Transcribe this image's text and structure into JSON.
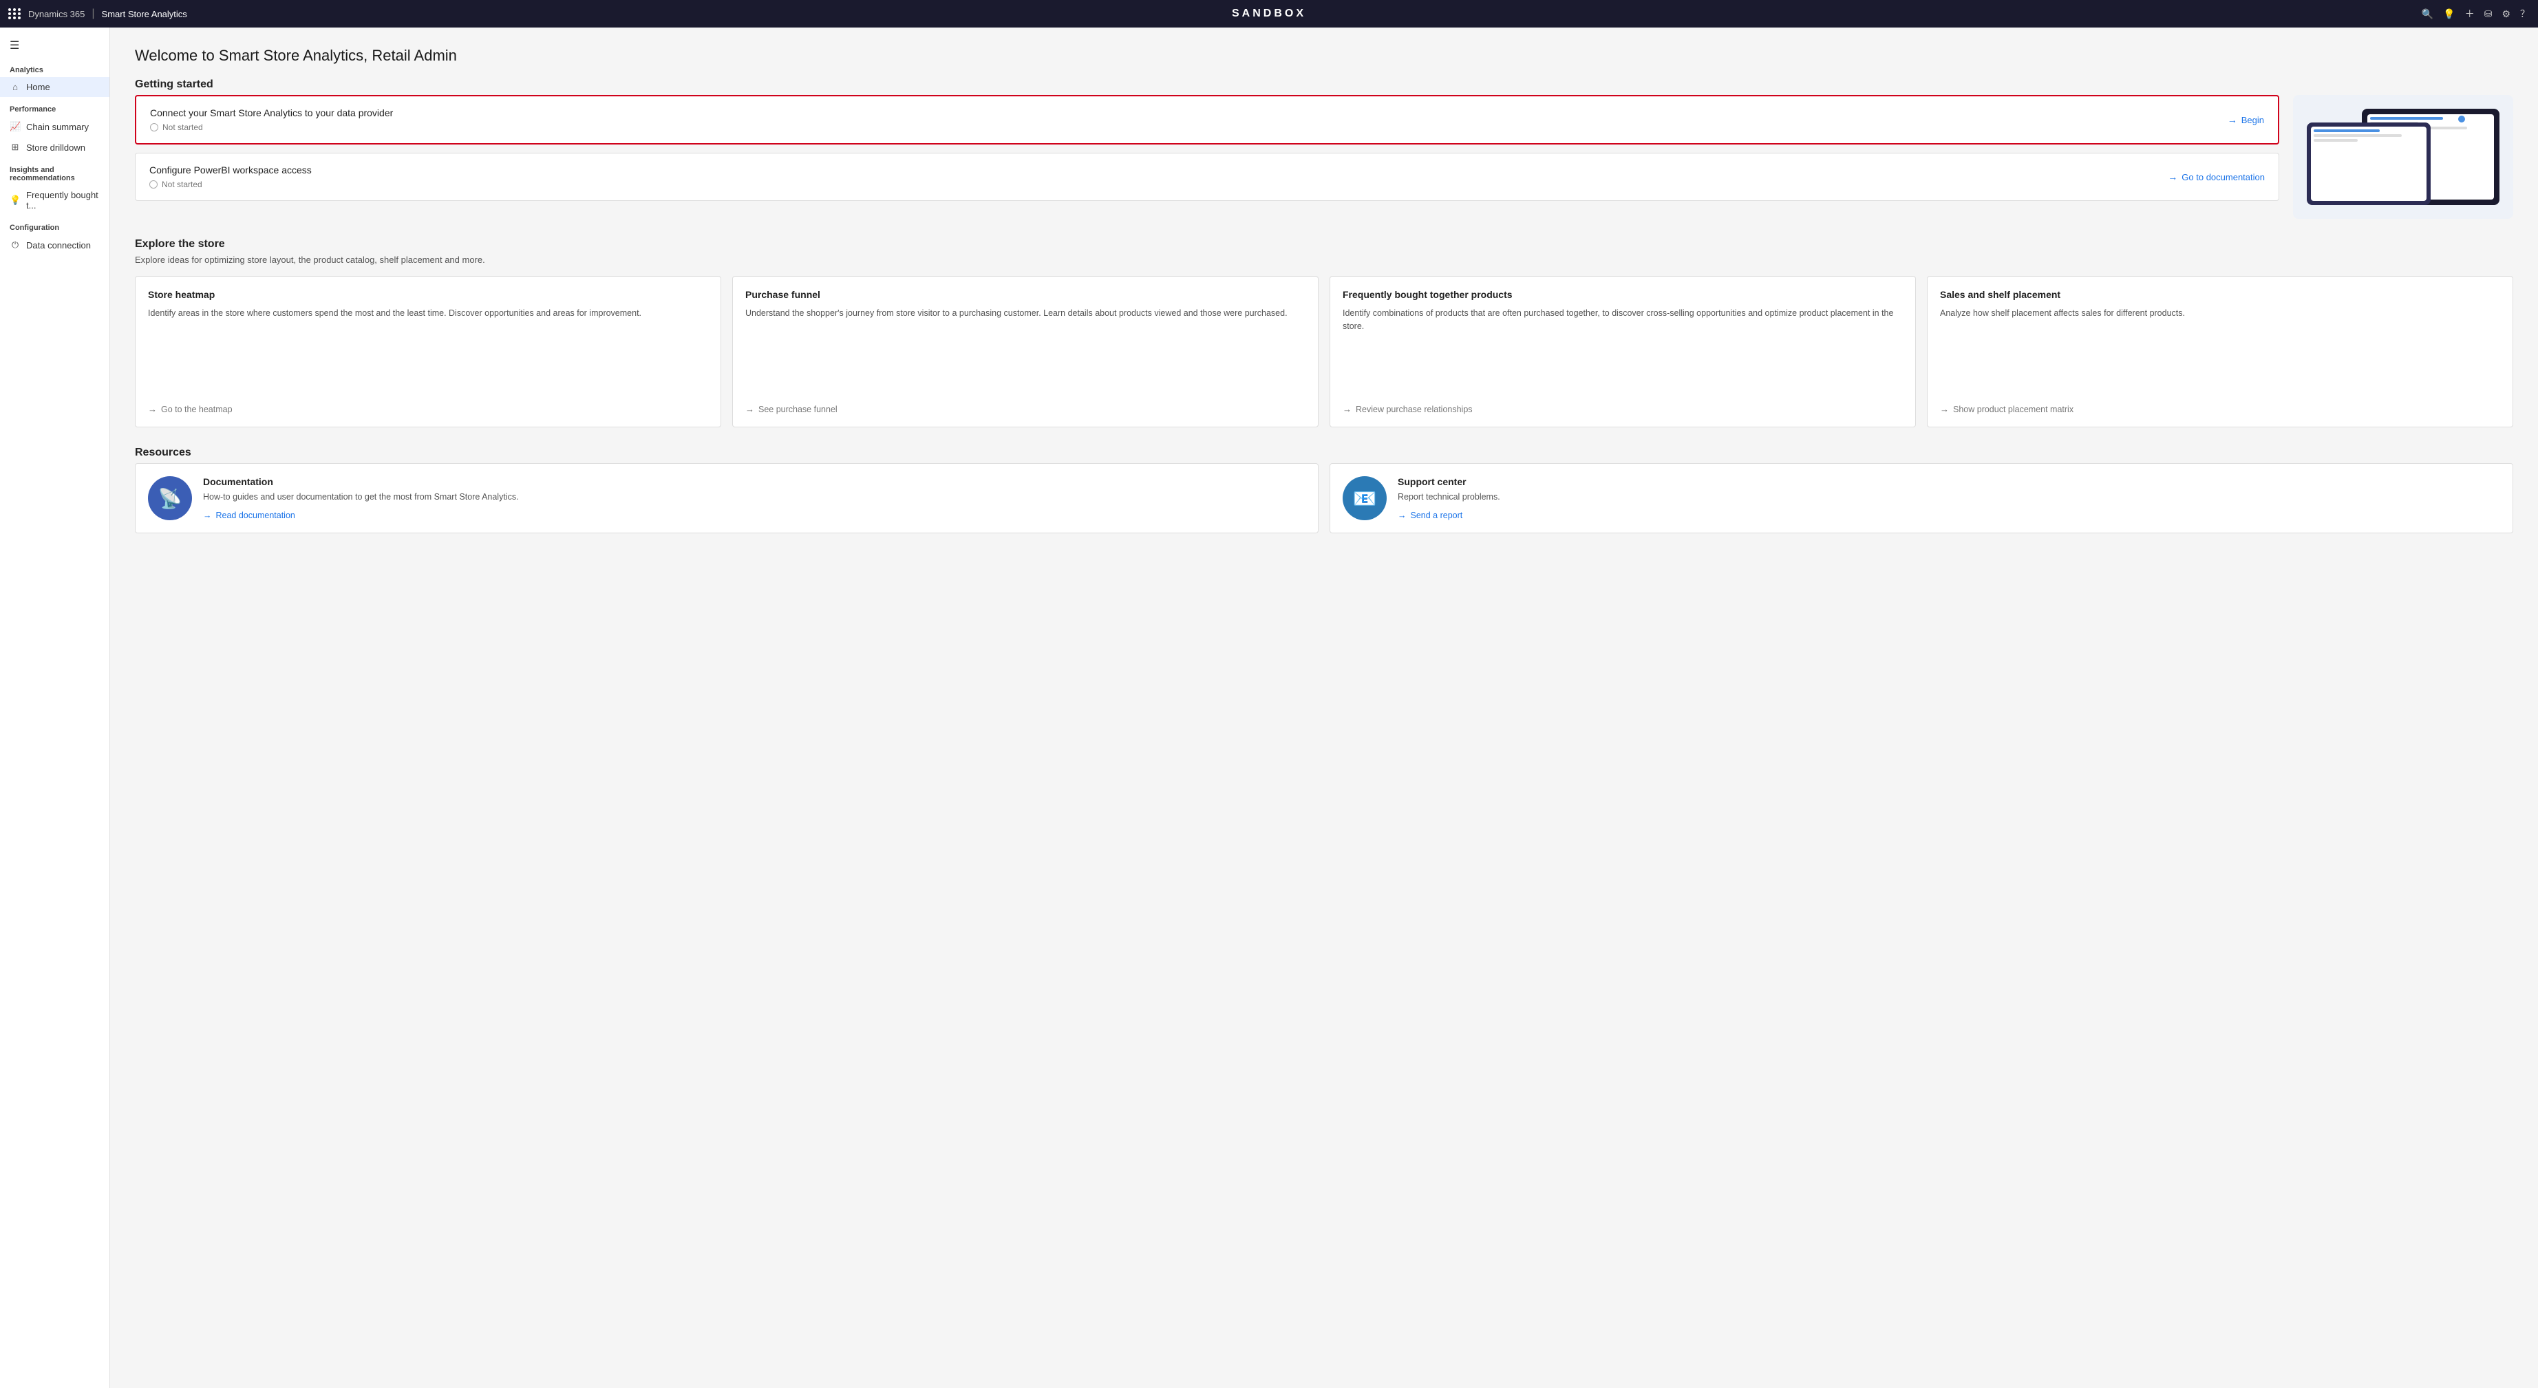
{
  "topbar": {
    "brand": "Dynamics 365",
    "separator": "|",
    "appname": "Smart Store Analytics",
    "sandbox_label": "SANDBOX",
    "icons": [
      "search",
      "lightbulb",
      "plus",
      "filter",
      "gear",
      "question"
    ]
  },
  "sidebar": {
    "analytics_label": "Analytics",
    "home_label": "Home",
    "performance_label": "Performance",
    "chain_summary_label": "Chain summary",
    "store_drilldown_label": "Store drilldown",
    "insights_label": "Insights and recommendations",
    "frequently_bought_label": "Frequently bought t...",
    "configuration_label": "Configuration",
    "data_connection_label": "Data connection"
  },
  "main": {
    "page_title": "Welcome to Smart Store Analytics, Retail Admin",
    "getting_started_title": "Getting started",
    "getting_started_cards": [
      {
        "title": "Connect your Smart Store Analytics to your data provider",
        "status": "Not started",
        "action_label": "Begin",
        "highlighted": true
      },
      {
        "title": "Configure PowerBI workspace access",
        "status": "Not started",
        "action_label": "Go to documentation",
        "highlighted": false
      }
    ],
    "explore_title": "Explore the store",
    "explore_subtitle": "Explore ideas for optimizing store layout, the product catalog, shelf placement and more.",
    "explore_cards": [
      {
        "title": "Store heatmap",
        "description": "Identify areas in the store where customers spend the most and the least time. Discover opportunities and areas for improvement.",
        "link_label": "Go to the heatmap"
      },
      {
        "title": "Purchase funnel",
        "description": "Understand the shopper's journey from store visitor to a purchasing customer. Learn details about products viewed and those were purchased.",
        "link_label": "See purchase funnel"
      },
      {
        "title": "Frequently bought together products",
        "description": "Identify combinations of products that are often purchased together, to discover cross-selling opportunities and optimize product placement in the store.",
        "link_label": "Review purchase relationships"
      },
      {
        "title": "Sales and shelf placement",
        "description": "Analyze how shelf placement affects sales for different products.",
        "link_label": "Show product placement matrix"
      }
    ],
    "resources_title": "Resources",
    "resource_cards": [
      {
        "title": "Documentation",
        "description": "How-to guides and user documentation to get the most from Smart Store Analytics.",
        "link_label": "Read documentation",
        "icon": "📡",
        "icon_class": "blue"
      },
      {
        "title": "Support center",
        "description": "Report technical problems.",
        "link_label": "Send a report",
        "icon": "📧",
        "icon_class": "teal"
      }
    ]
  }
}
